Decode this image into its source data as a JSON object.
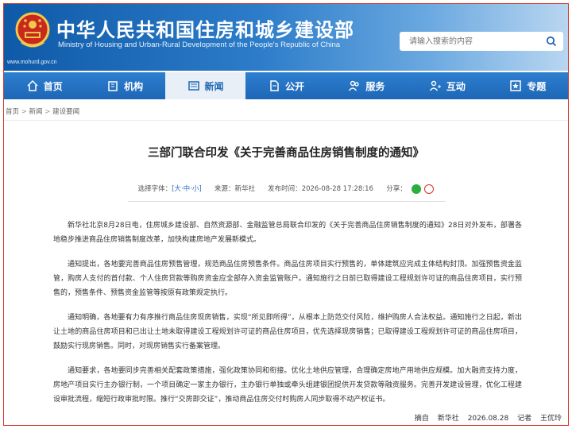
{
  "header": {
    "title": "中华人民共和国住房和城乡建设部",
    "subtitle": "Ministry of Housing and Urban-Rural Development of the People's Republic of China",
    "domain": "www.mohurd.gov.cn",
    "search_placeholder": "请输入搜索的内容",
    "brand_color": "#1e66b6"
  },
  "nav": {
    "items": [
      {
        "label": "首页",
        "icon": "home-icon"
      },
      {
        "label": "机构",
        "icon": "building-icon"
      },
      {
        "label": "新闻",
        "icon": "news-icon",
        "active": true
      },
      {
        "label": "公开",
        "icon": "document-icon"
      },
      {
        "label": "服务",
        "icon": "people-icon"
      },
      {
        "label": "互动",
        "icon": "chat-icon"
      },
      {
        "label": "专题",
        "icon": "topic-icon"
      }
    ]
  },
  "breadcrumb": [
    "首页",
    "新闻",
    "建设要闻"
  ],
  "article": {
    "title": "三部门联合印发《关于完善商品住房销售制度的通知》",
    "meta": {
      "font_label": "选择字体：",
      "font_open": "[",
      "font_large": "大",
      "font_mid": "中",
      "font_small": "小",
      "font_close": "]",
      "dot1": "·",
      "dot2": "·",
      "source_label": "来源：",
      "source": "新华社",
      "time_label": "发布时间：",
      "time": "2026-08-28 17:28:16",
      "share_label": "分享："
    },
    "paragraphs": [
      "新华社北京8月28日电，住房城乡建设部、自然资源部、金融监管总局联合印发的《关于完善商品住房销售制度的通知》28日对外发布，部署各地稳步推进商品住房销售制度改革，加快构建房地产发展新模式。",
      "通知提出，各地要完善商品住房预售管理，规范商品住房预售条件。商品住房项目实行预售的，单体建筑应完成主体结构封顶。加强预售资金监管，购房人支付的首付款、个人住房贷款等购房资金应全部存入资金监管账户。通知施行之日前已取得建设工程规划许可证的商品住房项目，实行预售的，预售条件、预售资金监管等按原有政策规定执行。",
      "通知明确，各地要有力有序推行商品住房现房销售，实现“所见即所得”，从根本上防范交付风险，维护购房人合法权益。通知施行之日起，新出让土地的商品住房项目和已出让土地未取得建设工程规划许可证的商品住房项目，优先选择现房销售；已取得建设工程规划许可证的商品住房项目，鼓励实行现房销售。同时，对现房销售实行备案管理。",
      "通知要求，各地要同步完善相关配套政策措施，强化政策协同和衔接。优化土地供应管理，合理确定房地产用地供应规模。加大融资支持力度，房地产项目实行主办银行制，一个项目确定一家主办银行，主办银行单独或牵头组建银团提供开发贷款等融资服务。完善开发建设管理，优化工程建设审批流程，缩短行政审批时限。推行“交房即交证”，推动商品住房交付时购房人同步取得不动产权证书。"
    ],
    "footer": {
      "excerpt_label": "摘自",
      "source": "新华社",
      "date": "2026.08.28",
      "reporter_label": "记者",
      "reporter": "王优玲"
    }
  }
}
